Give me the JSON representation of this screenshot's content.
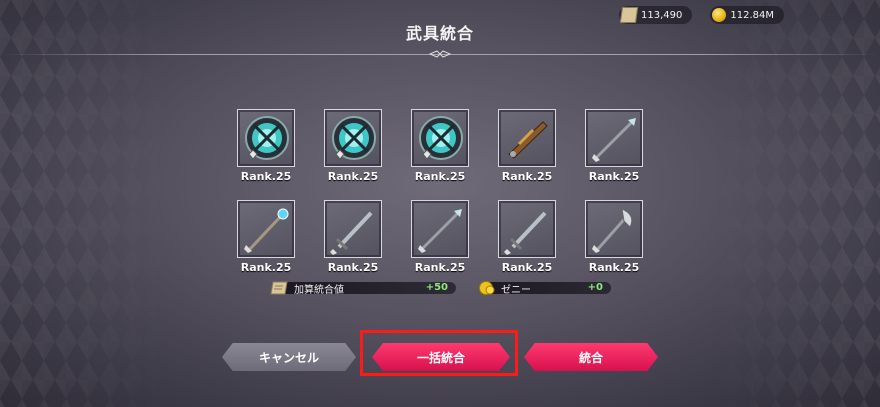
{
  "currencies": {
    "scroll_value": "113,490",
    "zeny_value": "112.84M"
  },
  "title": "武具統合",
  "items": [
    {
      "kind": "shield",
      "rank": "Rank.25"
    },
    {
      "kind": "shield",
      "rank": "Rank.25"
    },
    {
      "kind": "shield",
      "rank": "Rank.25"
    },
    {
      "kind": "gun",
      "rank": "Rank.25"
    },
    {
      "kind": "spear",
      "rank": "Rank.25"
    },
    {
      "kind": "staff",
      "rank": "Rank.25"
    },
    {
      "kind": "sword",
      "rank": "Rank.25"
    },
    {
      "kind": "spear",
      "rank": "Rank.25"
    },
    {
      "kind": "sword",
      "rank": "Rank.25"
    },
    {
      "kind": "axe",
      "rank": "Rank.25"
    }
  ],
  "stats": {
    "merge_value": {
      "label": "加算統合値",
      "value": "+50"
    },
    "zeny": {
      "label": "ゼニー",
      "value": "+0"
    }
  },
  "buttons": {
    "cancel": "キャンセル",
    "bulk_merge": "一括統合",
    "merge": "統合"
  },
  "colors": {
    "accent_pink": "#e8185a",
    "highlight_red": "#ff1a1a",
    "stat_green": "#8ee87a"
  }
}
